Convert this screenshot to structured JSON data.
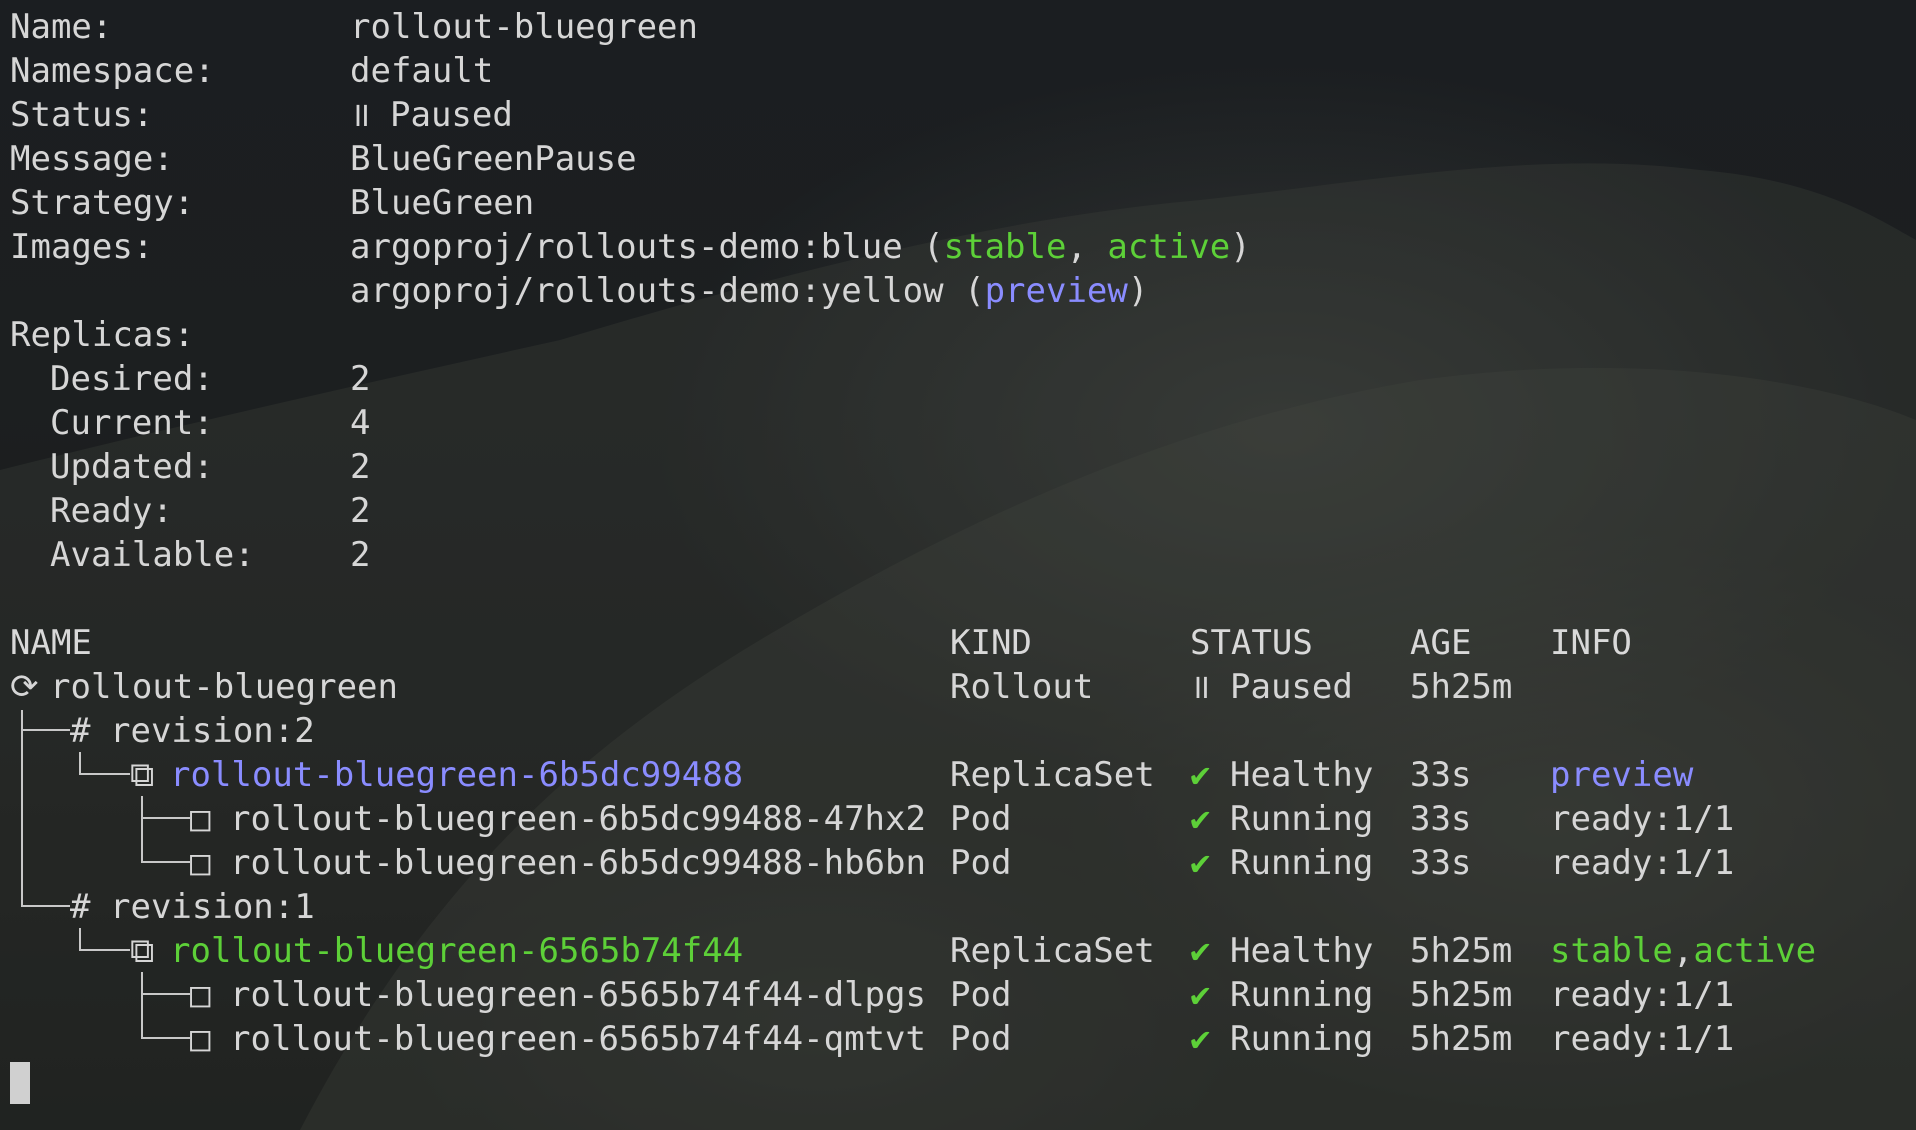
{
  "summary": {
    "name_label": "Name:",
    "name_value": "rollout-bluegreen",
    "namespace_label": "Namespace:",
    "namespace_value": "default",
    "status_label": "Status:",
    "status_icon": "॥",
    "status_value": "Paused",
    "message_label": "Message:",
    "message_value": "BlueGreenPause",
    "strategy_label": "Strategy:",
    "strategy_value": "BlueGreen",
    "images_label": "Images:",
    "image1": "argoproj/rollouts-demo:blue",
    "image1_open": " (",
    "image1_tag1": "stable",
    "image1_sep": ", ",
    "image1_tag2": "active",
    "image1_close": ")",
    "image2": "argoproj/rollouts-demo:yellow",
    "image2_open": " (",
    "image2_tag": "preview",
    "image2_close": ")",
    "replicas_label": "Replicas:",
    "desired_label": "Desired:",
    "desired_value": "2",
    "current_label": "Current:",
    "current_value": "4",
    "updated_label": "Updated:",
    "updated_value": "2",
    "ready_label": "Ready:",
    "ready_value": "2",
    "available_label": "Available:",
    "available_value": "2"
  },
  "table": {
    "headers": {
      "name": "NAME",
      "kind": "KIND",
      "status": "STATUS",
      "age": "AGE",
      "info": "INFO"
    },
    "rows": [
      {
        "prefix": "⟳ ",
        "name": "rollout-bluegreen",
        "kind": "Rollout",
        "status_icon": "॥",
        "status": "Paused",
        "age": "5h25m",
        "info": ""
      },
      {
        "prefix": "# ",
        "name": "revision:2",
        "kind": "",
        "status_icon": "",
        "status": "",
        "age": "",
        "info": ""
      },
      {
        "prefix": "⧉ ",
        "name": "rollout-bluegreen-6b5dc99488",
        "kind": "ReplicaSet",
        "status_icon": "✔",
        "status": "Healthy",
        "age": "33s",
        "info": "preview"
      },
      {
        "prefix": "□ ",
        "name": "rollout-bluegreen-6b5dc99488-47hx2",
        "kind": "Pod",
        "status_icon": "✔",
        "status": "Running",
        "age": "33s",
        "info": "ready:1/1"
      },
      {
        "prefix": "□ ",
        "name": "rollout-bluegreen-6b5dc99488-hb6bn",
        "kind": "Pod",
        "status_icon": "✔",
        "status": "Running",
        "age": "33s",
        "info": "ready:1/1"
      },
      {
        "prefix": "# ",
        "name": "revision:1",
        "kind": "",
        "status_icon": "",
        "status": "",
        "age": "",
        "info": ""
      },
      {
        "prefix": "⧉ ",
        "name": "rollout-bluegreen-6565b74f44",
        "kind": "ReplicaSet",
        "status_icon": "✔",
        "status": "Healthy",
        "age": "5h25m",
        "info_a": "stable",
        "info_sep": ",",
        "info_b": "active"
      },
      {
        "prefix": "□ ",
        "name": "rollout-bluegreen-6565b74f44-dlpgs",
        "kind": "Pod",
        "status_icon": "✔",
        "status": "Running",
        "age": "5h25m",
        "info": "ready:1/1"
      },
      {
        "prefix": "□ ",
        "name": "rollout-bluegreen-6565b74f44-qmtvt",
        "kind": "Pod",
        "status_icon": "✔",
        "status": "Running",
        "age": "5h25m",
        "info": "ready:1/1"
      }
    ]
  },
  "colors": {
    "green": "#5dd038",
    "purple": "#8a8cff",
    "text": "#d6d6d6"
  }
}
